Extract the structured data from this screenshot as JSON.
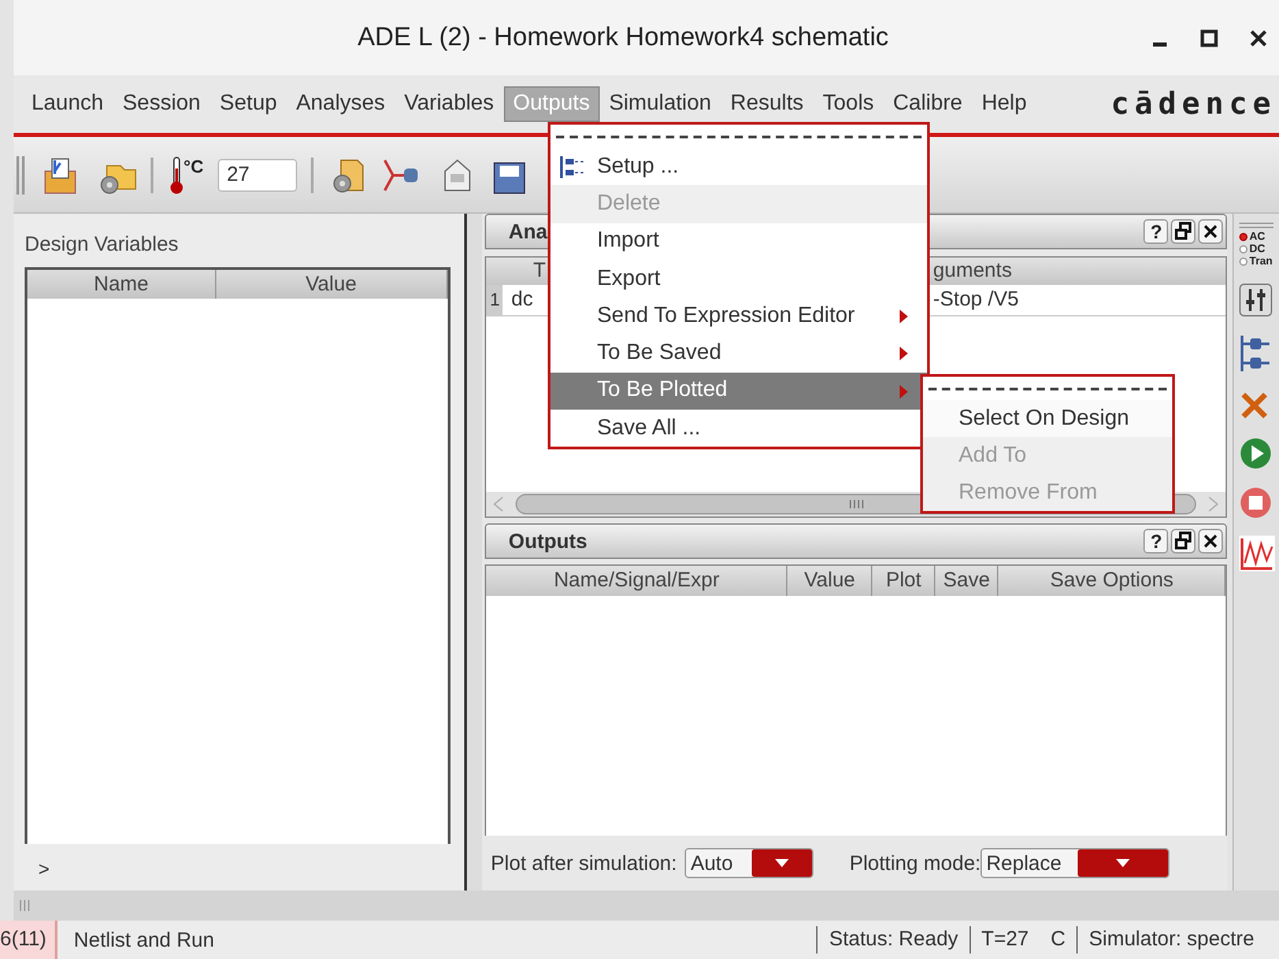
{
  "window": {
    "title": "ADE L (2) - Homework Homework4 schematic"
  },
  "menubar": {
    "items": [
      {
        "label": "Launch",
        "selected": false
      },
      {
        "label": "Session",
        "selected": false
      },
      {
        "label": "Setup",
        "selected": false
      },
      {
        "label": "Analyses",
        "selected": false
      },
      {
        "label": "Variables",
        "selected": false
      },
      {
        "label": "Outputs",
        "selected": true
      },
      {
        "label": "Simulation",
        "selected": false
      },
      {
        "label": "Results",
        "selected": false
      },
      {
        "label": "Tools",
        "selected": false
      },
      {
        "label": "Calibre",
        "selected": false
      },
      {
        "label": "Help",
        "selected": false
      }
    ],
    "logo": "cādence"
  },
  "toolbar": {
    "temperature_unit": "°C",
    "temperature": "27"
  },
  "design_variables": {
    "title": "Design Variables",
    "columns": [
      "Name",
      "Value"
    ],
    "expander": ">"
  },
  "analyses": {
    "title": "Ana",
    "help": "?",
    "columns": [
      "T",
      "guments"
    ],
    "rows": [
      {
        "index": "1",
        "type": "dc",
        "arguments": "-Stop /V5"
      }
    ]
  },
  "outputs": {
    "title": "Outputs",
    "help": "?",
    "columns": [
      "Name/Signal/Expr",
      "Value",
      "Plot",
      "Save",
      "Save Options"
    ],
    "plot_after_label": "Plot after simulation:",
    "plot_after": "Auto",
    "plotting_mode_label": "Plotting mode:",
    "plotting_mode": "Replace"
  },
  "right_toolbar": {
    "analysis_types": [
      {
        "label": "AC",
        "selected": true
      },
      {
        "label": "DC",
        "selected": false
      },
      {
        "label": "Tran",
        "selected": false
      }
    ]
  },
  "outputs_menu": {
    "items": [
      {
        "label": "Setup ...",
        "kind": "icon",
        "disabled": false,
        "selected": false,
        "submenu": false
      },
      {
        "label": "Delete",
        "kind": "plain",
        "disabled": true,
        "selected": false,
        "submenu": false
      },
      {
        "label": "Import",
        "kind": "plain",
        "disabled": false,
        "selected": false,
        "submenu": false
      },
      {
        "label": "Export",
        "kind": "plain",
        "disabled": false,
        "selected": false,
        "submenu": false
      },
      {
        "label": "Send To Expression Editor",
        "kind": "plain",
        "disabled": false,
        "selected": false,
        "submenu": true
      },
      {
        "label": "To Be Saved",
        "kind": "plain",
        "disabled": false,
        "selected": false,
        "submenu": true
      },
      {
        "label": "To Be Plotted",
        "kind": "plain",
        "disabled": false,
        "selected": true,
        "submenu": true
      },
      {
        "label": "Save All ...",
        "kind": "plain",
        "disabled": false,
        "selected": false,
        "submenu": false
      }
    ]
  },
  "plotted_submenu": {
    "items": [
      {
        "label": "Select On Design",
        "disabled": false,
        "selected": false
      },
      {
        "label": "Add To",
        "disabled": true,
        "selected": false
      },
      {
        "label": "Remove From",
        "disabled": true,
        "selected": false
      }
    ]
  },
  "status_bar": {
    "counter": "6(11)",
    "action": "Netlist and Run",
    "status": "Status: Ready",
    "temperature": "T=27",
    "unit": "C",
    "simulator": "Simulator: spectre"
  }
}
